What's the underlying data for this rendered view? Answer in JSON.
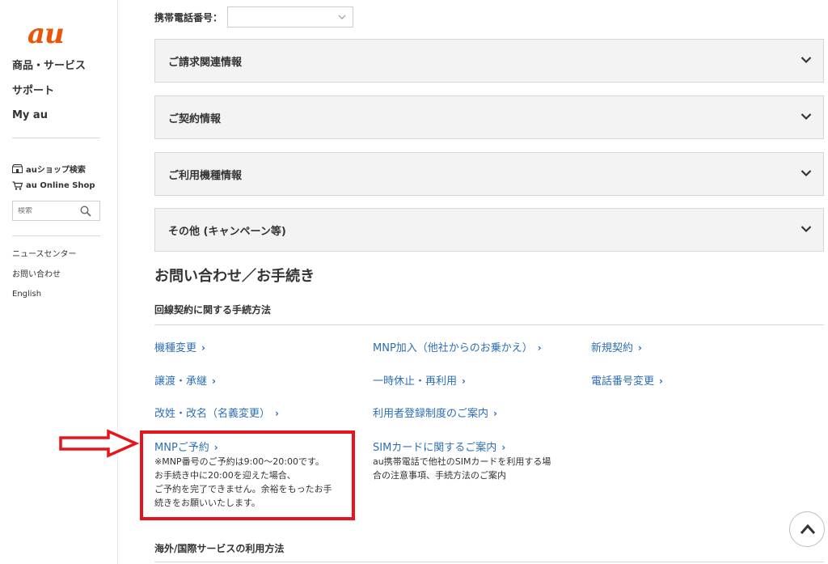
{
  "brand": {
    "logo": "au",
    "color": "#eb5505"
  },
  "sidebar": {
    "main_nav": [
      "商品・サービス",
      "サポート",
      "My au"
    ],
    "shop_search": "auショップ検索",
    "online_shop": "au Online Shop",
    "search_placeholder": "検索",
    "links": [
      "ニュースセンター",
      "お問い合わせ",
      "English"
    ]
  },
  "phone": {
    "label": "携帯電話番号：",
    "value": ""
  },
  "accordions": [
    "ご請求関連情報",
    "ご契約情報",
    "ご利用機種情報",
    "その他 (キャンペーン等)"
  ],
  "section": {
    "title": "お問い合わせ／お手続き",
    "subtitle1": "回線契約に関する手続方法",
    "subtitle2": "海外/国際サービスの利用方法"
  },
  "procedures": {
    "kishu_henko": "機種変更",
    "mnp_kanyu": "MNP加入（他社からのお乗かえ）",
    "shinki": "新規契約",
    "joto": "譲渡・承継",
    "kyushi": "一時休止・再利用",
    "bango_henko": "電話番号変更",
    "kaisei": "改姓・改名（名義変更）",
    "riyosha": "利用者登録制度のご案内",
    "mnp_yoyaku": "MNPご予約",
    "mnp_note": [
      "※MNP番号のご予約は9:00〜20:00です。",
      "お手続き中に20:00を迎えた場合、",
      "ご予約を完了できません。余裕をもったお手",
      "続きをお願いいたします。"
    ],
    "sim": "SIMカードに関するご案内",
    "sim_note": [
      "au携帯電話で他社のSIMカードを利用する場",
      "合の注意事項、手続方法のご案内"
    ]
  },
  "colors": {
    "link": "#2d6fb5",
    "highlight": "#e8141b"
  },
  "icons": {
    "arrow": "chevron-right-icon",
    "accordion": "chevron-down-icon",
    "back_to_top": "chevron-up-icon"
  }
}
